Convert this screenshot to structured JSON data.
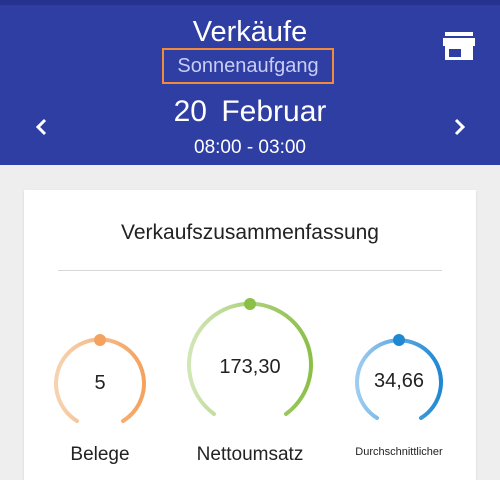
{
  "header": {
    "title": "Verkäufe",
    "subtitle": "Sonnenaufgang",
    "date": "20 Februar",
    "time_range": "08:00 - 03:00",
    "background": "#2f3ea3",
    "highlight_color": "#f08a3c",
    "prev_icon": "chevron-left-icon",
    "next_icon": "chevron-right-icon",
    "store_icon": "store-icon"
  },
  "summary": {
    "title": "Verkaufszusammenfassung",
    "metrics": [
      {
        "label": "Belege",
        "value": "5",
        "color": "#f4a25e",
        "light_color": "#f7d2b0"
      },
      {
        "label": "Nettoumsatz",
        "value": "173,30",
        "color": "#8bbf47",
        "light_color": "#d2e6b6"
      },
      {
        "label": "Durchschnittlicher",
        "value": "34,66",
        "color": "#1e88d2",
        "light_color": "#9dcdf0"
      }
    ]
  }
}
